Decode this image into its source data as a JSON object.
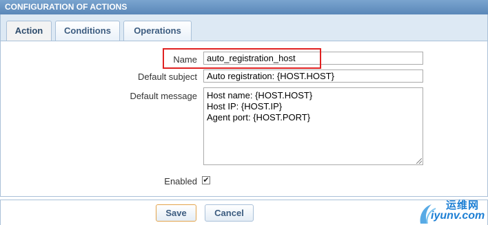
{
  "header": {
    "title": "CONFIGURATION OF ACTIONS"
  },
  "tabs": [
    {
      "label": "Action",
      "active": true
    },
    {
      "label": "Conditions",
      "active": false
    },
    {
      "label": "Operations",
      "active": false
    }
  ],
  "form": {
    "name_label": "Name",
    "name_value": "auto_registration_host",
    "subject_label": "Default subject",
    "subject_value": "Auto registration: {HOST.HOST}",
    "message_label": "Default message",
    "message_lines": [
      "Host name: {HOST.HOST}",
      "Host IP: {HOST.IP}",
      "Agent port: {HOST.PORT}"
    ],
    "enabled_label": "Enabled",
    "enabled_checked": true,
    "enabled_mark": "✔"
  },
  "buttons": {
    "save": "Save",
    "cancel": "Cancel"
  },
  "watermark": {
    "cn": "运维网",
    "en": "iyunv.com"
  },
  "colors": {
    "highlight": "#e02020",
    "header": "#5a87b8",
    "accent": "#3c5c80"
  }
}
